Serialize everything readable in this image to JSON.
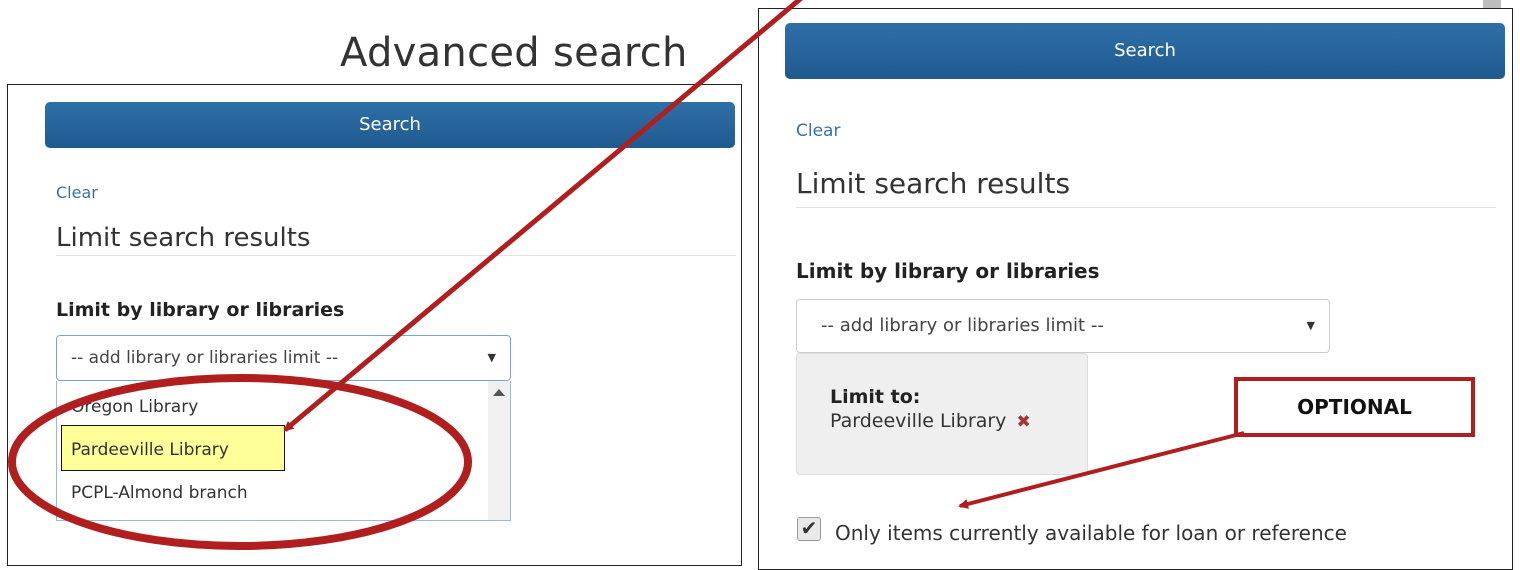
{
  "page_title": "Advanced search",
  "left_panel": {
    "search_label": "Search",
    "clear_label": "Clear",
    "limit_heading": "Limit search results",
    "limit_by_label": "Limit by library or libraries",
    "select_value": "-- add library or libraries limit --",
    "options": [
      "Oregon Library",
      "Pardeeville Library",
      "PCPL-Almond branch"
    ],
    "selected_option": "Pardeeville Library"
  },
  "right_panel": {
    "search_label": "Search",
    "clear_label": "Clear",
    "limit_heading": "Limit search results",
    "limit_by_label": "Limit by library or libraries",
    "select_value": "-- add library or libraries limit --",
    "limit_to_label": "Limit to:",
    "limit_to_value": "Pardeeville Library",
    "remove_symbol": "✖",
    "available_label": "Only items currently available for loan or reference",
    "available_checked": "✔"
  },
  "annotation": {
    "optional_label": "OPTIONAL",
    "color": "#b01e1e"
  },
  "colors": {
    "button_blue": "#2a6aa3",
    "link_blue": "#3a72a8",
    "highlight_yellow": "#ffff99"
  }
}
